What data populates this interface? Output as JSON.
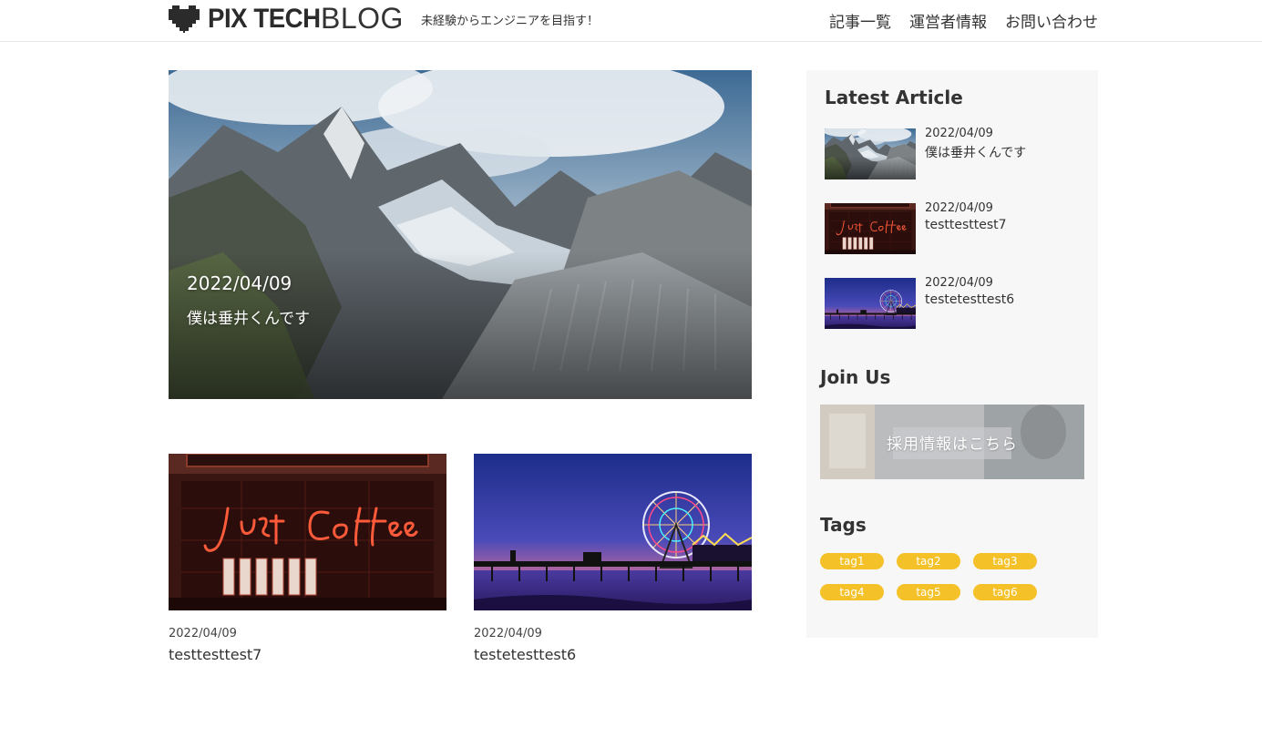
{
  "header": {
    "logo_text": "PIX TECH",
    "logo_blog": "BLOG",
    "tagline": "未経験からエンジニアを目指す！",
    "nav": [
      "記事一覧",
      "運営者情報",
      "お問い合わせ"
    ]
  },
  "hero": {
    "date": "2022/04/09",
    "title": "僕は垂井くんです",
    "image": "mountain-glacier-photo"
  },
  "cards": [
    {
      "date": "2022/04/09",
      "title": "testtesttest7",
      "image": "just-coffee-neon-photo"
    },
    {
      "date": "2022/04/09",
      "title": "testetesttest6",
      "image": "ferris-wheel-pier-photo"
    }
  ],
  "sidebar": {
    "latest_heading": "Latest Article",
    "latest": [
      {
        "date": "2022/04/09",
        "title": "僕は垂井くんです",
        "image": "mountain-glacier-photo"
      },
      {
        "date": "2022/04/09",
        "title": "testtesttest7",
        "image": "just-coffee-neon-photo"
      },
      {
        "date": "2022/04/09",
        "title": "testetesttest6",
        "image": "ferris-wheel-pier-photo"
      }
    ],
    "join_heading": "Join Us",
    "join_banner": "採用情報はこちら",
    "tags_heading": "Tags",
    "tags": [
      "tag1",
      "tag2",
      "tag3",
      "tag4",
      "tag5",
      "tag6"
    ]
  },
  "colors": {
    "tag_bg": "#f5c128",
    "sidebar_bg": "#f7f7f7",
    "text": "#333333"
  }
}
